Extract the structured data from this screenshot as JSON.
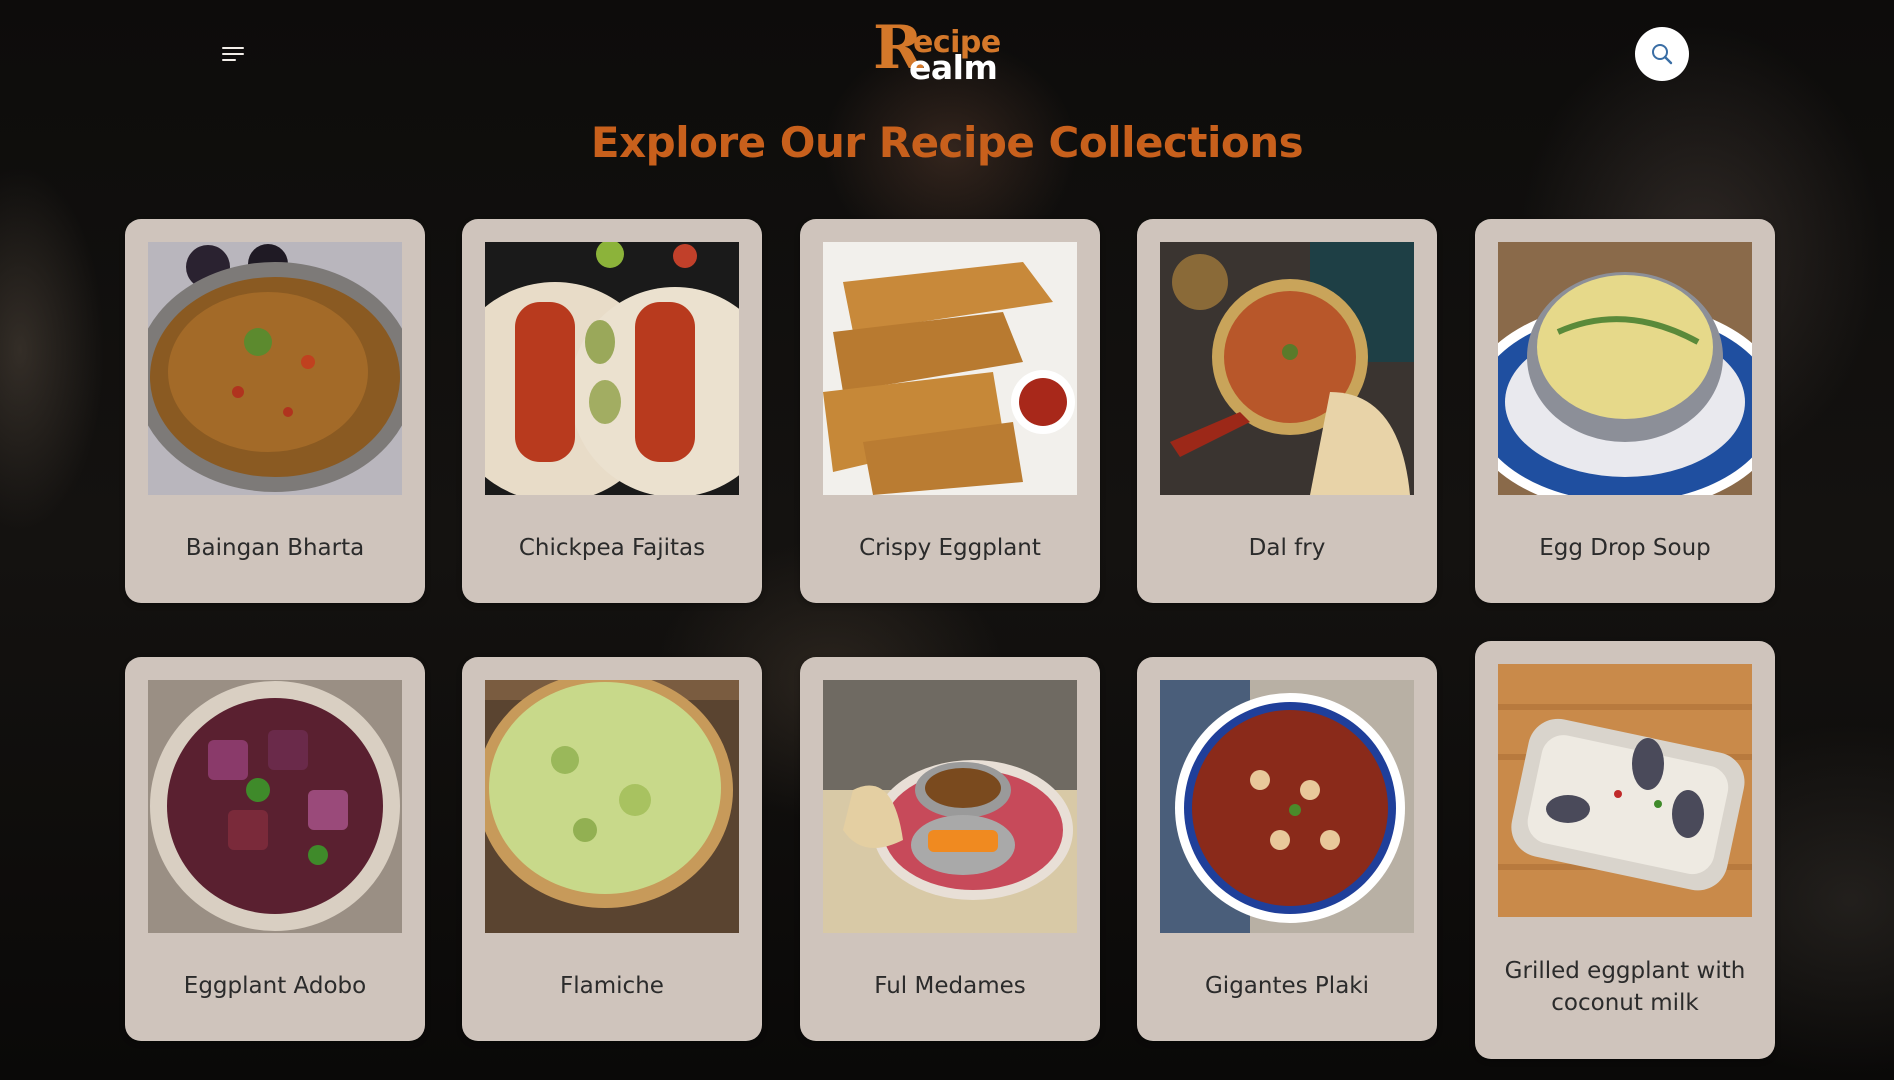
{
  "header": {
    "menu_icon": "hamburger-menu-icon",
    "logo": {
      "initial": "R",
      "top_word": "ecipe",
      "bottom_word": "ealm"
    },
    "search_icon": "search-icon"
  },
  "page_title": "Explore Our Recipe Collections",
  "recipes": [
    {
      "name": "Baingan Bharta"
    },
    {
      "name": "Chickpea Fajitas"
    },
    {
      "name": "Crispy Eggplant"
    },
    {
      "name": "Dal fry"
    },
    {
      "name": "Egg Drop Soup"
    },
    {
      "name": "Eggplant Adobo"
    },
    {
      "name": "Flamiche"
    },
    {
      "name": "Ful Medames"
    },
    {
      "name": "Gigantes Plaki"
    },
    {
      "name": "Grilled eggplant with coconut milk"
    }
  ],
  "colors": {
    "accent": "#c8601c",
    "card_bg": "#cfc4bc",
    "page_bg": "#0b0a09"
  }
}
